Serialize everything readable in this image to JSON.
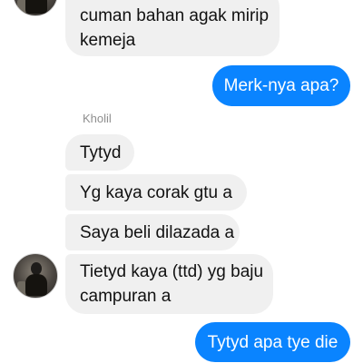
{
  "chat": {
    "messages": {
      "m0": {
        "line1": "cuman bahan agak mirip",
        "line2": "kemeja"
      },
      "m1": "Merk-nya apa?",
      "sender": "Kholil",
      "m2": "Tytyd",
      "m3": "Yg kaya corak gtu a",
      "m4": "Saya beli dilazada a",
      "m5": {
        "line1": "Tietyd kaya (ttd) yg baju",
        "line2": "campuran a"
      },
      "m6": "Tytyd apa tye die"
    }
  },
  "colors": {
    "outgoing_bubble": "#0a84ff",
    "incoming_bubble": "#f0f0f0",
    "sender_name": "#8e8e8e"
  }
}
